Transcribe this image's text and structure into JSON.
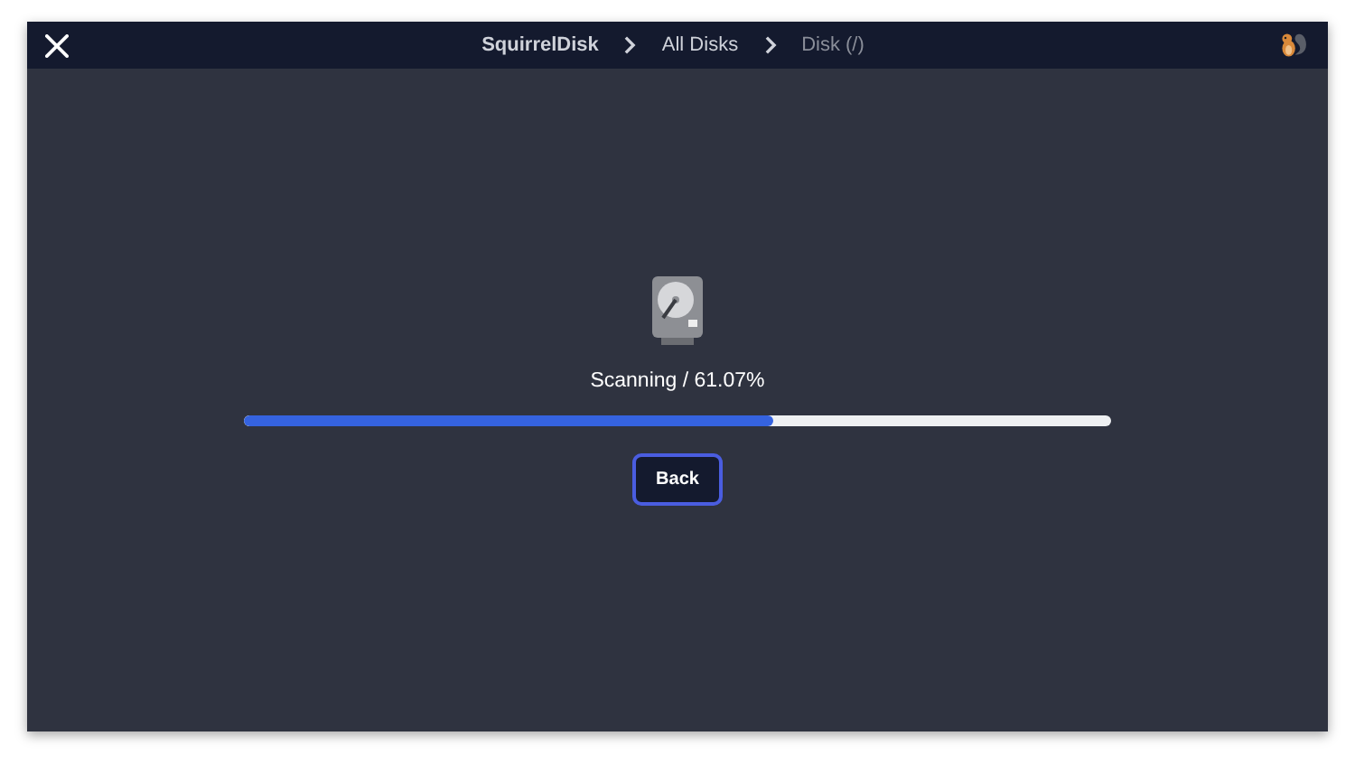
{
  "breadcrumbs": [
    {
      "label": "SquirrelDisk",
      "current": false
    },
    {
      "label": "All Disks",
      "current": false
    },
    {
      "label": "Disk (/)",
      "current": true
    }
  ],
  "scan": {
    "status": "Scanning / 61.07%",
    "level": 0.6107
  },
  "buttons": [
    "Back"
  ]
}
